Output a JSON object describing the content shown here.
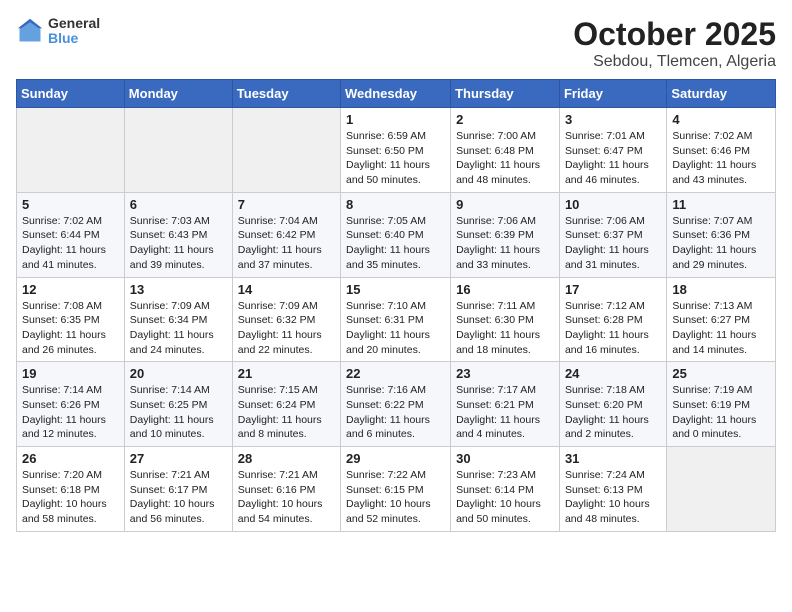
{
  "logo": {
    "line1": "General",
    "line2": "Blue"
  },
  "title": "October 2025",
  "subtitle": "Sebdou, Tlemcen, Algeria",
  "weekdays": [
    "Sunday",
    "Monday",
    "Tuesday",
    "Wednesday",
    "Thursday",
    "Friday",
    "Saturday"
  ],
  "weeks": [
    [
      {
        "day": "",
        "info": ""
      },
      {
        "day": "",
        "info": ""
      },
      {
        "day": "",
        "info": ""
      },
      {
        "day": "1",
        "info": "Sunrise: 6:59 AM\nSunset: 6:50 PM\nDaylight: 11 hours and 50 minutes."
      },
      {
        "day": "2",
        "info": "Sunrise: 7:00 AM\nSunset: 6:48 PM\nDaylight: 11 hours and 48 minutes."
      },
      {
        "day": "3",
        "info": "Sunrise: 7:01 AM\nSunset: 6:47 PM\nDaylight: 11 hours and 46 minutes."
      },
      {
        "day": "4",
        "info": "Sunrise: 7:02 AM\nSunset: 6:46 PM\nDaylight: 11 hours and 43 minutes."
      }
    ],
    [
      {
        "day": "5",
        "info": "Sunrise: 7:02 AM\nSunset: 6:44 PM\nDaylight: 11 hours and 41 minutes."
      },
      {
        "day": "6",
        "info": "Sunrise: 7:03 AM\nSunset: 6:43 PM\nDaylight: 11 hours and 39 minutes."
      },
      {
        "day": "7",
        "info": "Sunrise: 7:04 AM\nSunset: 6:42 PM\nDaylight: 11 hours and 37 minutes."
      },
      {
        "day": "8",
        "info": "Sunrise: 7:05 AM\nSunset: 6:40 PM\nDaylight: 11 hours and 35 minutes."
      },
      {
        "day": "9",
        "info": "Sunrise: 7:06 AM\nSunset: 6:39 PM\nDaylight: 11 hours and 33 minutes."
      },
      {
        "day": "10",
        "info": "Sunrise: 7:06 AM\nSunset: 6:37 PM\nDaylight: 11 hours and 31 minutes."
      },
      {
        "day": "11",
        "info": "Sunrise: 7:07 AM\nSunset: 6:36 PM\nDaylight: 11 hours and 29 minutes."
      }
    ],
    [
      {
        "day": "12",
        "info": "Sunrise: 7:08 AM\nSunset: 6:35 PM\nDaylight: 11 hours and 26 minutes."
      },
      {
        "day": "13",
        "info": "Sunrise: 7:09 AM\nSunset: 6:34 PM\nDaylight: 11 hours and 24 minutes."
      },
      {
        "day": "14",
        "info": "Sunrise: 7:09 AM\nSunset: 6:32 PM\nDaylight: 11 hours and 22 minutes."
      },
      {
        "day": "15",
        "info": "Sunrise: 7:10 AM\nSunset: 6:31 PM\nDaylight: 11 hours and 20 minutes."
      },
      {
        "day": "16",
        "info": "Sunrise: 7:11 AM\nSunset: 6:30 PM\nDaylight: 11 hours and 18 minutes."
      },
      {
        "day": "17",
        "info": "Sunrise: 7:12 AM\nSunset: 6:28 PM\nDaylight: 11 hours and 16 minutes."
      },
      {
        "day": "18",
        "info": "Sunrise: 7:13 AM\nSunset: 6:27 PM\nDaylight: 11 hours and 14 minutes."
      }
    ],
    [
      {
        "day": "19",
        "info": "Sunrise: 7:14 AM\nSunset: 6:26 PM\nDaylight: 11 hours and 12 minutes."
      },
      {
        "day": "20",
        "info": "Sunrise: 7:14 AM\nSunset: 6:25 PM\nDaylight: 11 hours and 10 minutes."
      },
      {
        "day": "21",
        "info": "Sunrise: 7:15 AM\nSunset: 6:24 PM\nDaylight: 11 hours and 8 minutes."
      },
      {
        "day": "22",
        "info": "Sunrise: 7:16 AM\nSunset: 6:22 PM\nDaylight: 11 hours and 6 minutes."
      },
      {
        "day": "23",
        "info": "Sunrise: 7:17 AM\nSunset: 6:21 PM\nDaylight: 11 hours and 4 minutes."
      },
      {
        "day": "24",
        "info": "Sunrise: 7:18 AM\nSunset: 6:20 PM\nDaylight: 11 hours and 2 minutes."
      },
      {
        "day": "25",
        "info": "Sunrise: 7:19 AM\nSunset: 6:19 PM\nDaylight: 11 hours and 0 minutes."
      }
    ],
    [
      {
        "day": "26",
        "info": "Sunrise: 7:20 AM\nSunset: 6:18 PM\nDaylight: 10 hours and 58 minutes."
      },
      {
        "day": "27",
        "info": "Sunrise: 7:21 AM\nSunset: 6:17 PM\nDaylight: 10 hours and 56 minutes."
      },
      {
        "day": "28",
        "info": "Sunrise: 7:21 AM\nSunset: 6:16 PM\nDaylight: 10 hours and 54 minutes."
      },
      {
        "day": "29",
        "info": "Sunrise: 7:22 AM\nSunset: 6:15 PM\nDaylight: 10 hours and 52 minutes."
      },
      {
        "day": "30",
        "info": "Sunrise: 7:23 AM\nSunset: 6:14 PM\nDaylight: 10 hours and 50 minutes."
      },
      {
        "day": "31",
        "info": "Sunrise: 7:24 AM\nSunset: 6:13 PM\nDaylight: 10 hours and 48 minutes."
      },
      {
        "day": "",
        "info": ""
      }
    ]
  ]
}
